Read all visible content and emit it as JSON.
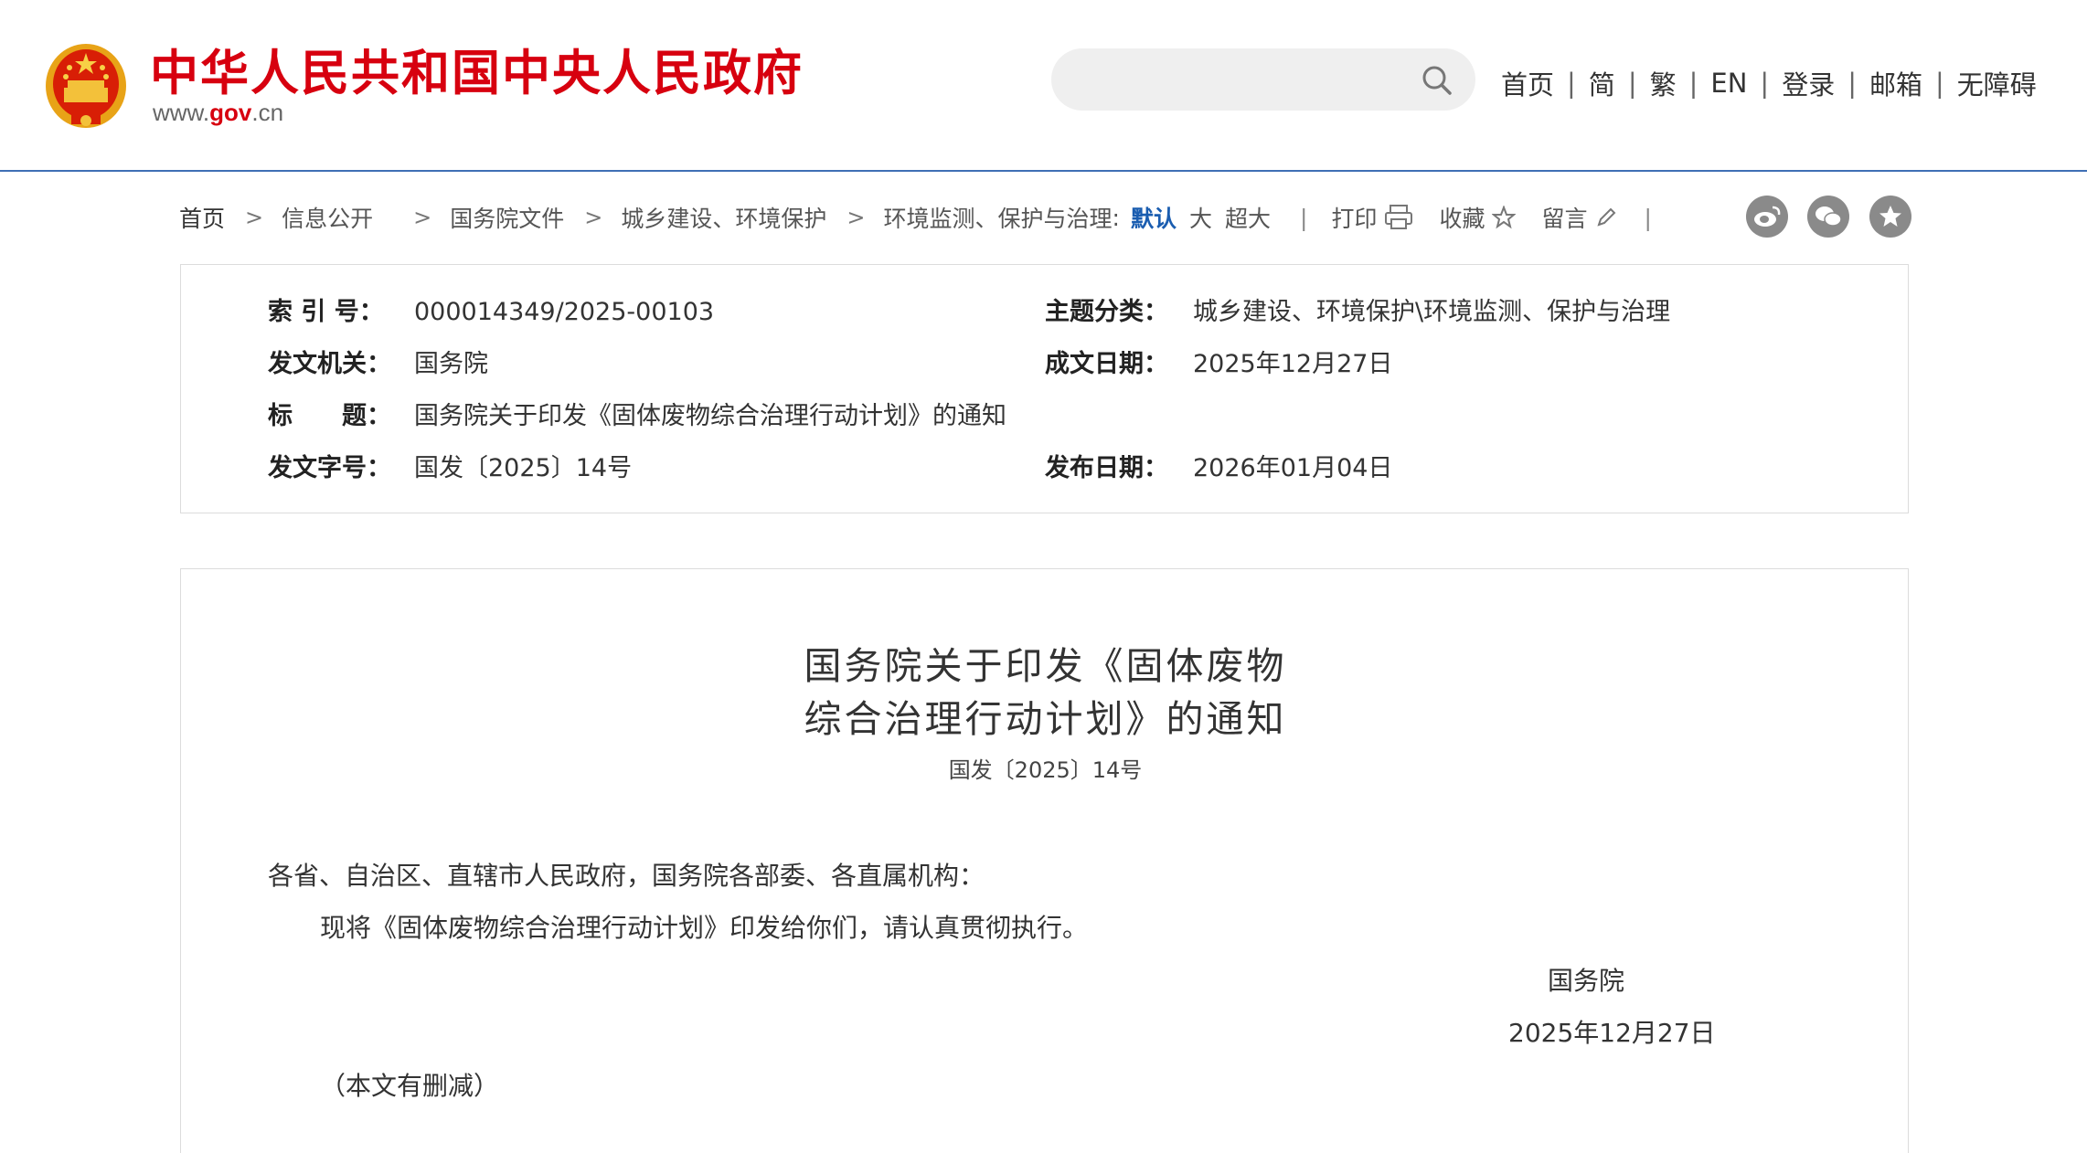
{
  "header": {
    "title": "中华人民共和国中央人民政府",
    "domain_prefix": "www.",
    "domain_gov": "gov",
    "domain_suffix": ".cn",
    "search_placeholder": "",
    "nav": [
      "首页",
      "简",
      "繁",
      "EN",
      "登录",
      "邮箱",
      "无障碍"
    ]
  },
  "breadcrumb": {
    "items": [
      "首页",
      "信息公开",
      "国务院文件",
      "城乡建设、环境保护",
      "环境监测、保护与治理"
    ],
    "font_size_label": "默认",
    "font_sizes": [
      "大",
      "超大"
    ],
    "tools": [
      "打印",
      "收藏",
      "留言"
    ]
  },
  "meta": {
    "index_label": "索 引 号：",
    "index_value": "000014349/2025-00103",
    "topic_label": "主题分类：",
    "topic_value": "城乡建设、环境保护\\环境监测、保护与治理",
    "issuer_label": "发文机关：",
    "issuer_value": "国务院",
    "written_date_label": "成文日期：",
    "written_date_value": "2025年12月27日",
    "title_label": "标　　题：",
    "title_value": "国务院关于印发《固体废物综合治理行动计划》的通知",
    "doc_no_label": "发文字号：",
    "doc_no_value": "国发〔2025〕14号",
    "publish_date_label": "发布日期：",
    "publish_date_value": "2026年01月04日"
  },
  "document": {
    "title_line1": "国务院关于印发《固体废物",
    "title_line2": "综合治理行动计划》的通知",
    "number": "国发〔2025〕14号",
    "salutation": "各省、自治区、直辖市人民政府，国务院各部委、各直属机构：",
    "body": "现将《固体废物综合治理行动计划》印发给你们，请认真贯彻执行。",
    "signature": "国务院",
    "date": "2025年12月27日",
    "note": "（本文有删减）"
  },
  "colors": {
    "title_red": "#d7000f",
    "header_line": "#3f6fb5",
    "active_blue": "#1a5db0",
    "share_gray": "#8a8a8a"
  }
}
